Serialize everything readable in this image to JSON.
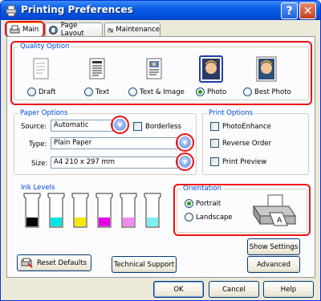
{
  "window": {
    "title": "Printing Preferences",
    "help_label": "?",
    "close_label": "✕"
  },
  "tabs": [
    {
      "label": "Main",
      "selected": true
    },
    {
      "label": "Page Layout",
      "selected": false
    },
    {
      "label": "Maintenance",
      "selected": false
    }
  ],
  "quality": {
    "title": "Quality Option",
    "options": [
      {
        "label": "Draft",
        "selected": false
      },
      {
        "label": "Text",
        "selected": false
      },
      {
        "label": "Text & Image",
        "selected": false
      },
      {
        "label": "Photo",
        "selected": true
      },
      {
        "label": "Best Photo",
        "selected": false
      }
    ]
  },
  "paper": {
    "title": "Paper Options",
    "source_label": "Source:",
    "source_value": "Automatic",
    "borderless_label": "Borderless",
    "type_label": "Type:",
    "type_value": "Plain Paper",
    "size_label": "Size:",
    "size_value": "A4 210 x 297 mm"
  },
  "print_options": {
    "title": "Print Options",
    "items": [
      "PhotoEnhance",
      "Reverse Order",
      "Print Preview"
    ]
  },
  "ink": {
    "title": "Ink Levels",
    "colors": [
      "#000000",
      "#00e5e5",
      "#f5e600",
      "#e600e6",
      "#f08cf0",
      "#7ff0f0"
    ]
  },
  "orientation": {
    "title": "Orientation",
    "options": [
      {
        "label": "Portrait",
        "selected": true
      },
      {
        "label": "Landscape",
        "selected": false
      }
    ]
  },
  "buttons": {
    "show_settings": "Show Settings",
    "reset_defaults": "Reset Defaults",
    "technical_support": "Technical Support",
    "advanced": "Advanced",
    "ok": "OK",
    "cancel": "Cancel",
    "help": "Help"
  },
  "accent": {
    "highlight": "#e11111",
    "group_title": "#0046d5"
  }
}
